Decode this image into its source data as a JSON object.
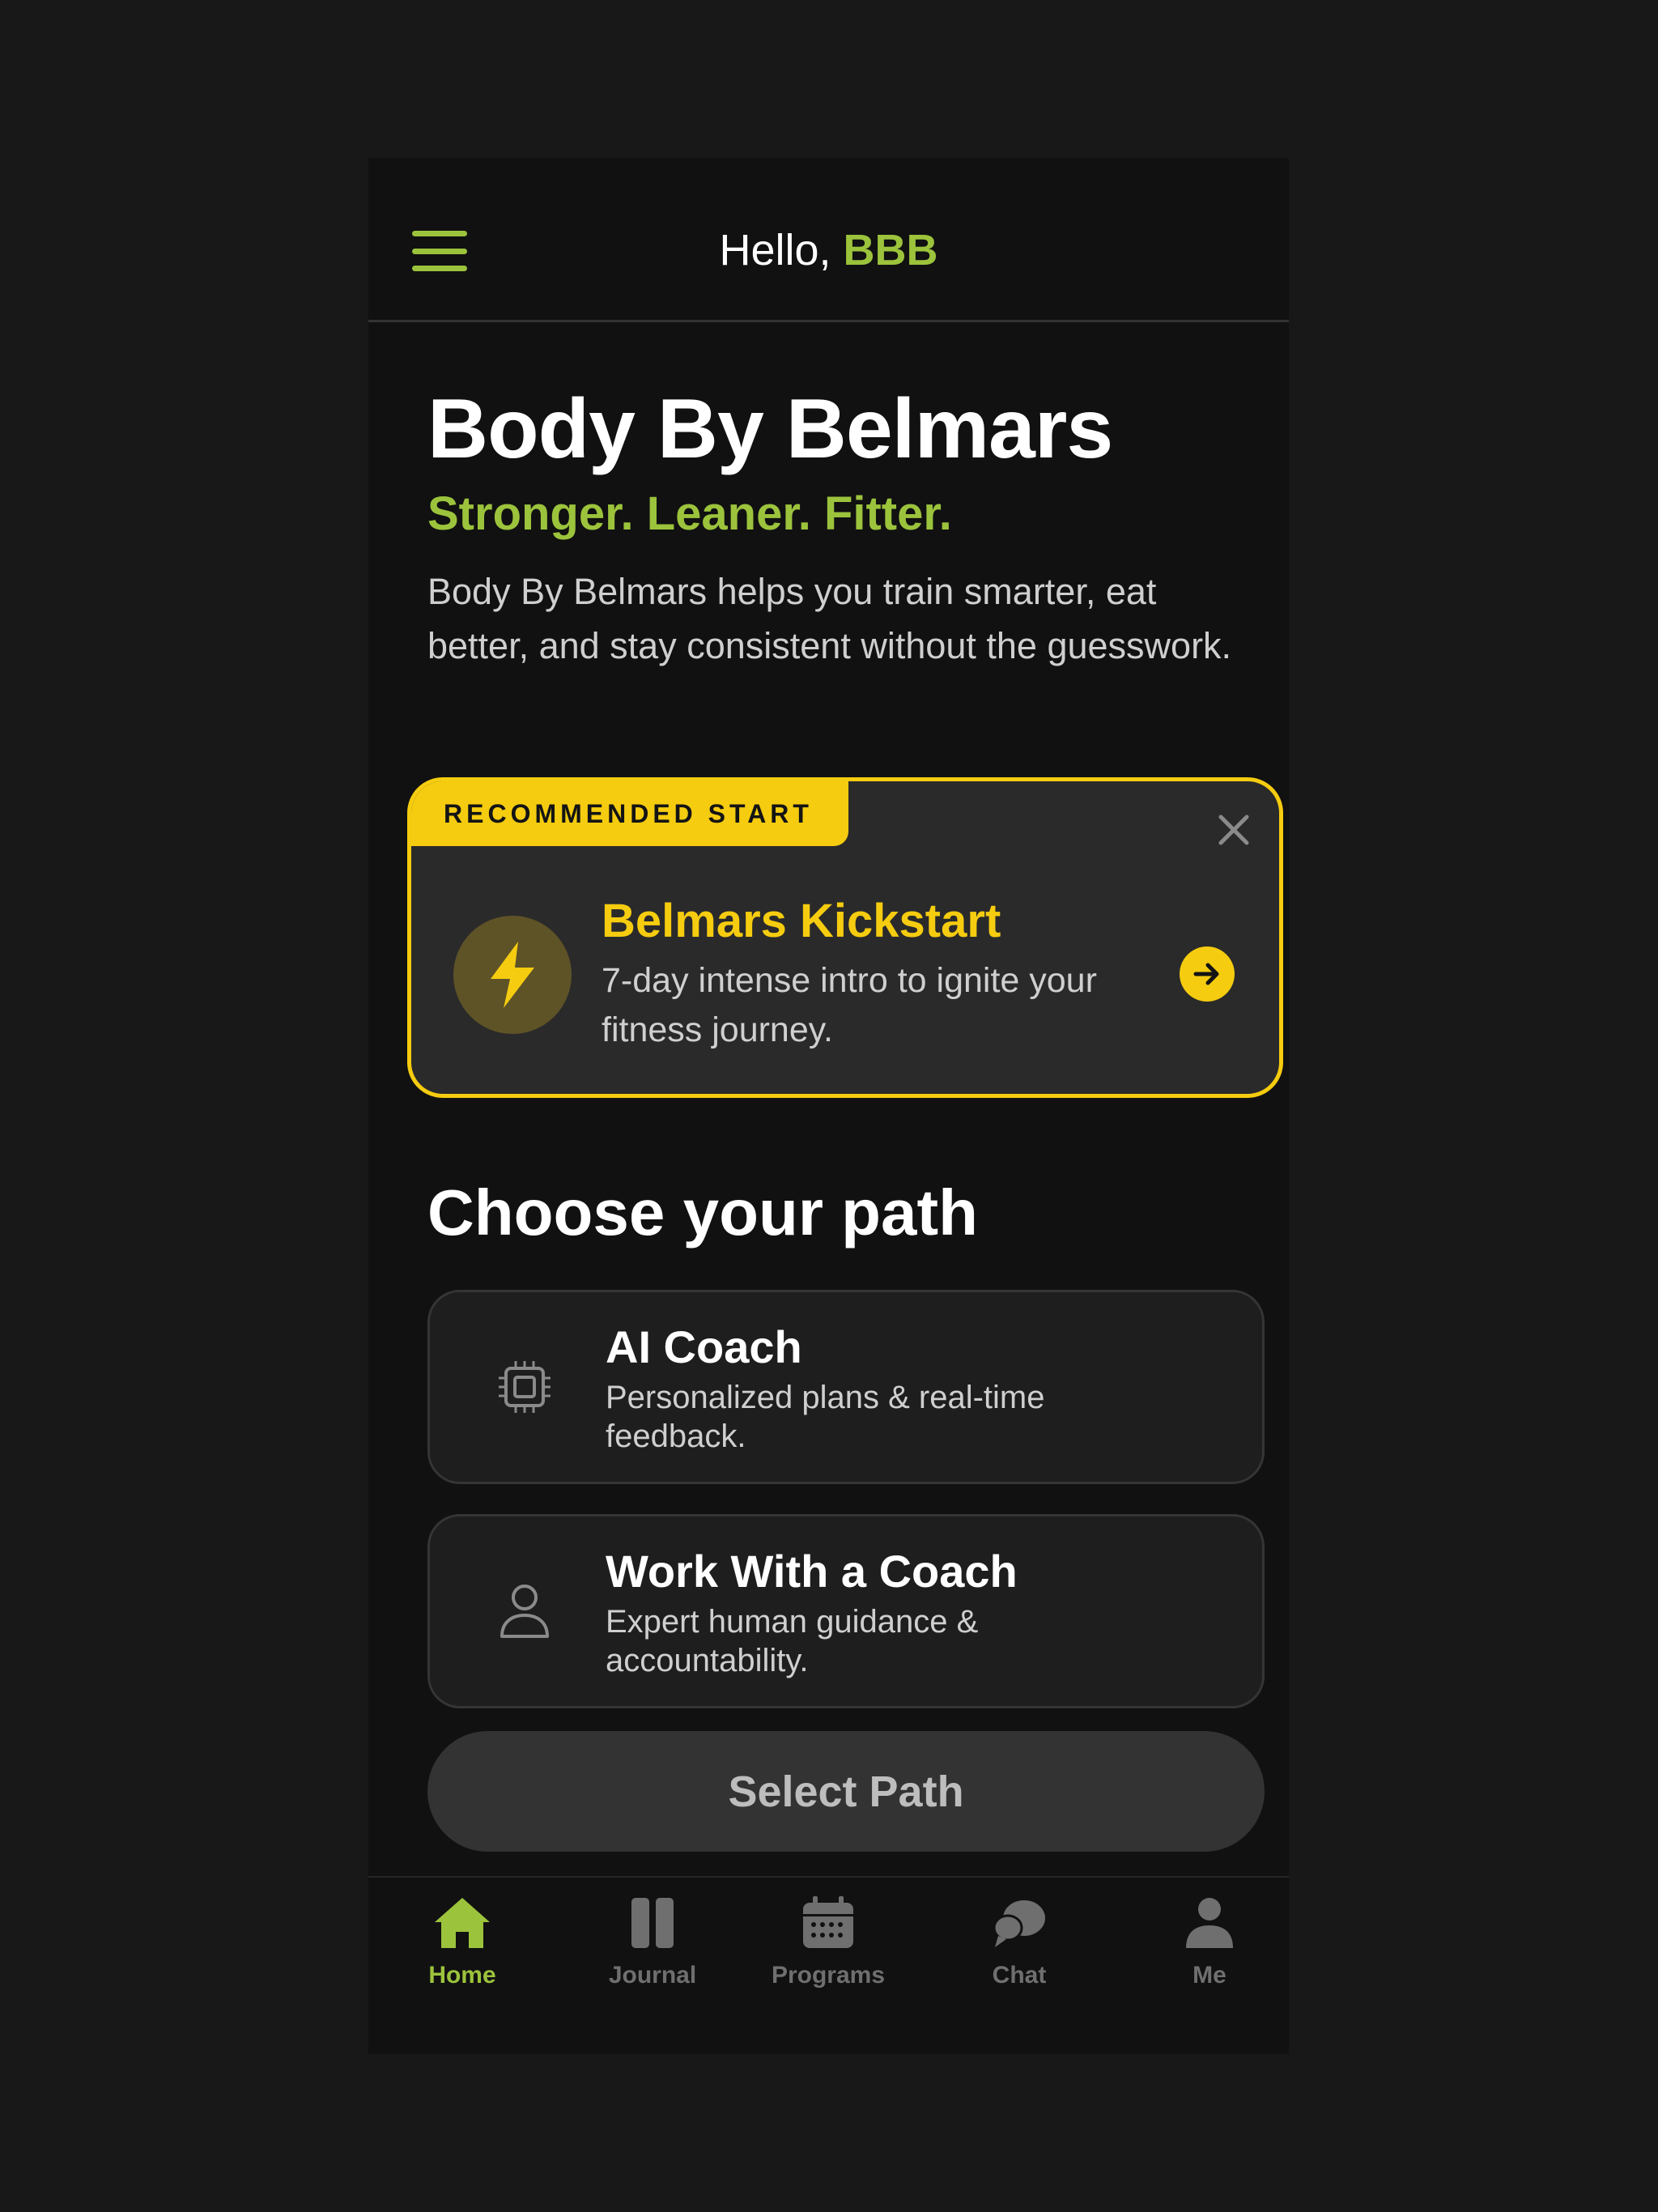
{
  "header": {
    "greeting_prefix": "Hello, ",
    "user_name": "BBB"
  },
  "hero": {
    "title": "Body By Belmars",
    "tagline": "Stronger. Leaner. Fitter.",
    "description": "Body By Belmars helps you train smarter, eat better, and stay consistent without the guesswork."
  },
  "recommended": {
    "badge": "RECOMMENDED START",
    "title": "Belmars Kickstart",
    "description": "7-day intense intro to ignite your fitness journey.",
    "close_icon": "close-icon",
    "icon": "lightning-bolt-icon",
    "arrow_icon": "arrow-right-icon"
  },
  "paths": {
    "section_title": "Choose your path",
    "items": [
      {
        "title": "AI Coach",
        "description": "Personalized plans & real-time feedback.",
        "icon": "cpu-chip-icon"
      },
      {
        "title": "Work With a Coach",
        "description": "Expert human guidance & accountability.",
        "icon": "person-icon"
      }
    ],
    "select_label": "Select Path"
  },
  "tabbar": {
    "items": [
      {
        "label": "Home",
        "icon": "home-icon",
        "active": true
      },
      {
        "label": "Journal",
        "icon": "journal-icon",
        "active": false
      },
      {
        "label": "Programs",
        "icon": "calendar-icon",
        "active": false
      },
      {
        "label": "Chat",
        "icon": "chat-icon",
        "active": false
      },
      {
        "label": "Me",
        "icon": "user-icon",
        "active": false
      }
    ]
  },
  "colors": {
    "accent_green": "#9cc33c",
    "accent_yellow": "#f5cc0f",
    "background": "#111111"
  }
}
